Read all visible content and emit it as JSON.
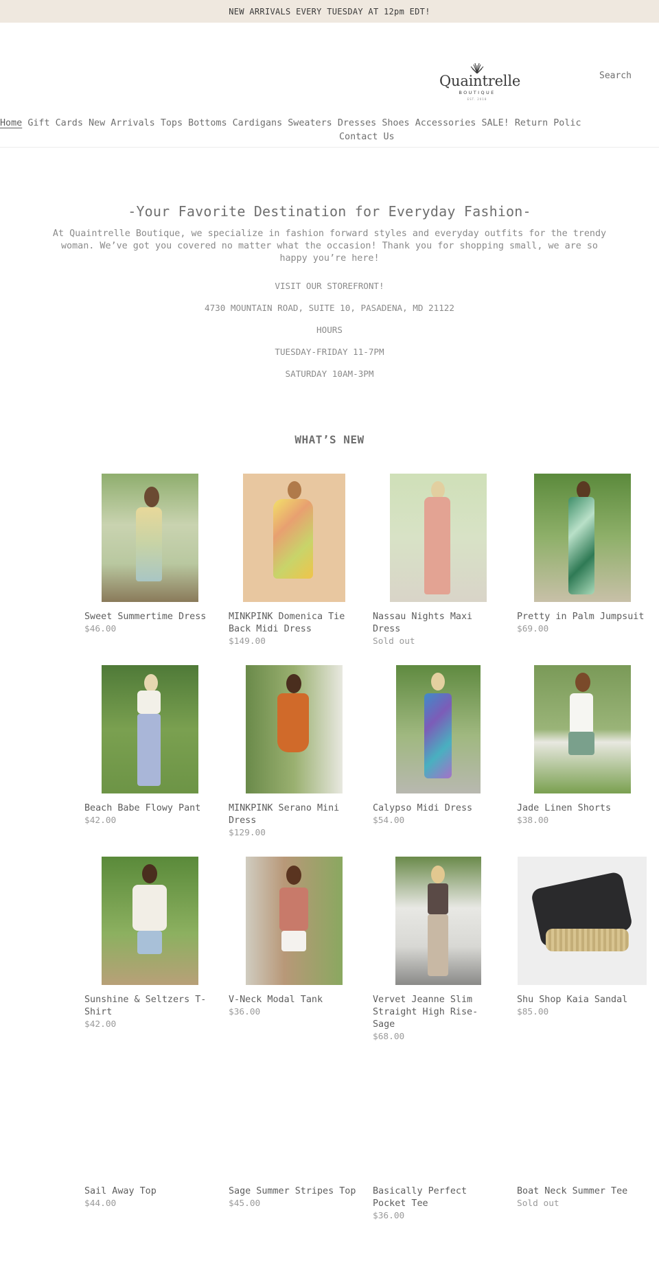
{
  "announcement": "NEW ARRIVALS EVERY TUESDAY AT 12pm EDT!",
  "logo": {
    "name": "Quaintrelle",
    "sub": "BOUTIQUE",
    "est": "EST. 2018"
  },
  "search_label": "Search",
  "nav": {
    "items": [
      "Home",
      "Gift Cards",
      "New Arrivals",
      "Tops",
      "Bottoms",
      "Cardigans",
      "Sweaters",
      "Dresses",
      "Shoes",
      "Accessories",
      "SALE!",
      "Return Polic"
    ],
    "contact": "Contact Us"
  },
  "intro": {
    "heading": "-Your Favorite Destination for Everyday Fashion-",
    "description": "At Quaintrelle Boutique, we specialize in fashion forward styles and everyday outfits for the trendy woman. We’ve got you covered no matter what the occasion! Thank you for shopping small, we are so happy you’re here!",
    "storefront": "VISIT OUR STOREFRONT!",
    "address": "4730 MOUNTAIN ROAD, SUITE 10, PASADENA, MD 21122",
    "hours_label": "HOURS",
    "weekday_hours": "TUESDAY-FRIDAY 11-7PM",
    "saturday_hours": "SATURDAY 10AM-3PM"
  },
  "whats_new": "WHAT’S NEW",
  "products": [
    {
      "title": "Sweet Summertime Dress",
      "price": "$46.00"
    },
    {
      "title": "MINKPINK Domenica Tie Back Midi Dress",
      "price": "$149.00"
    },
    {
      "title": "Nassau Nights Maxi Dress",
      "price": "Sold out"
    },
    {
      "title": "Pretty in Palm Jumpsuit",
      "price": "$69.00"
    },
    {
      "title": "Beach Babe Flowy Pant",
      "price": "$42.00"
    },
    {
      "title": "MINKPINK Serano Mini Dress",
      "price": "$129.00"
    },
    {
      "title": "Calypso Midi Dress",
      "price": "$54.00"
    },
    {
      "title": "Jade Linen Shorts",
      "price": "$38.00"
    },
    {
      "title": "Sunshine & Seltzers T-Shirt",
      "price": "$42.00"
    },
    {
      "title": "V-Neck Modal Tank",
      "price": "$36.00"
    },
    {
      "title": "Vervet Jeanne Slim Straight High Rise- Sage",
      "price": "$68.00"
    },
    {
      "title": "Shu Shop Kaia Sandal",
      "price": "$85.00"
    },
    {
      "title": "Sail Away Top",
      "price": "$44.00"
    },
    {
      "title": "Sage Summer Stripes Top",
      "price": "$45.00"
    },
    {
      "title": "Basically Perfect Pocket Tee",
      "price": "$36.00"
    },
    {
      "title": "Boat Neck Summer Tee",
      "price": "Sold out"
    }
  ],
  "colors": {
    "announcement_bg": "#efe8df",
    "text": "#6b6b6b",
    "muted": "#9a9a9a"
  }
}
